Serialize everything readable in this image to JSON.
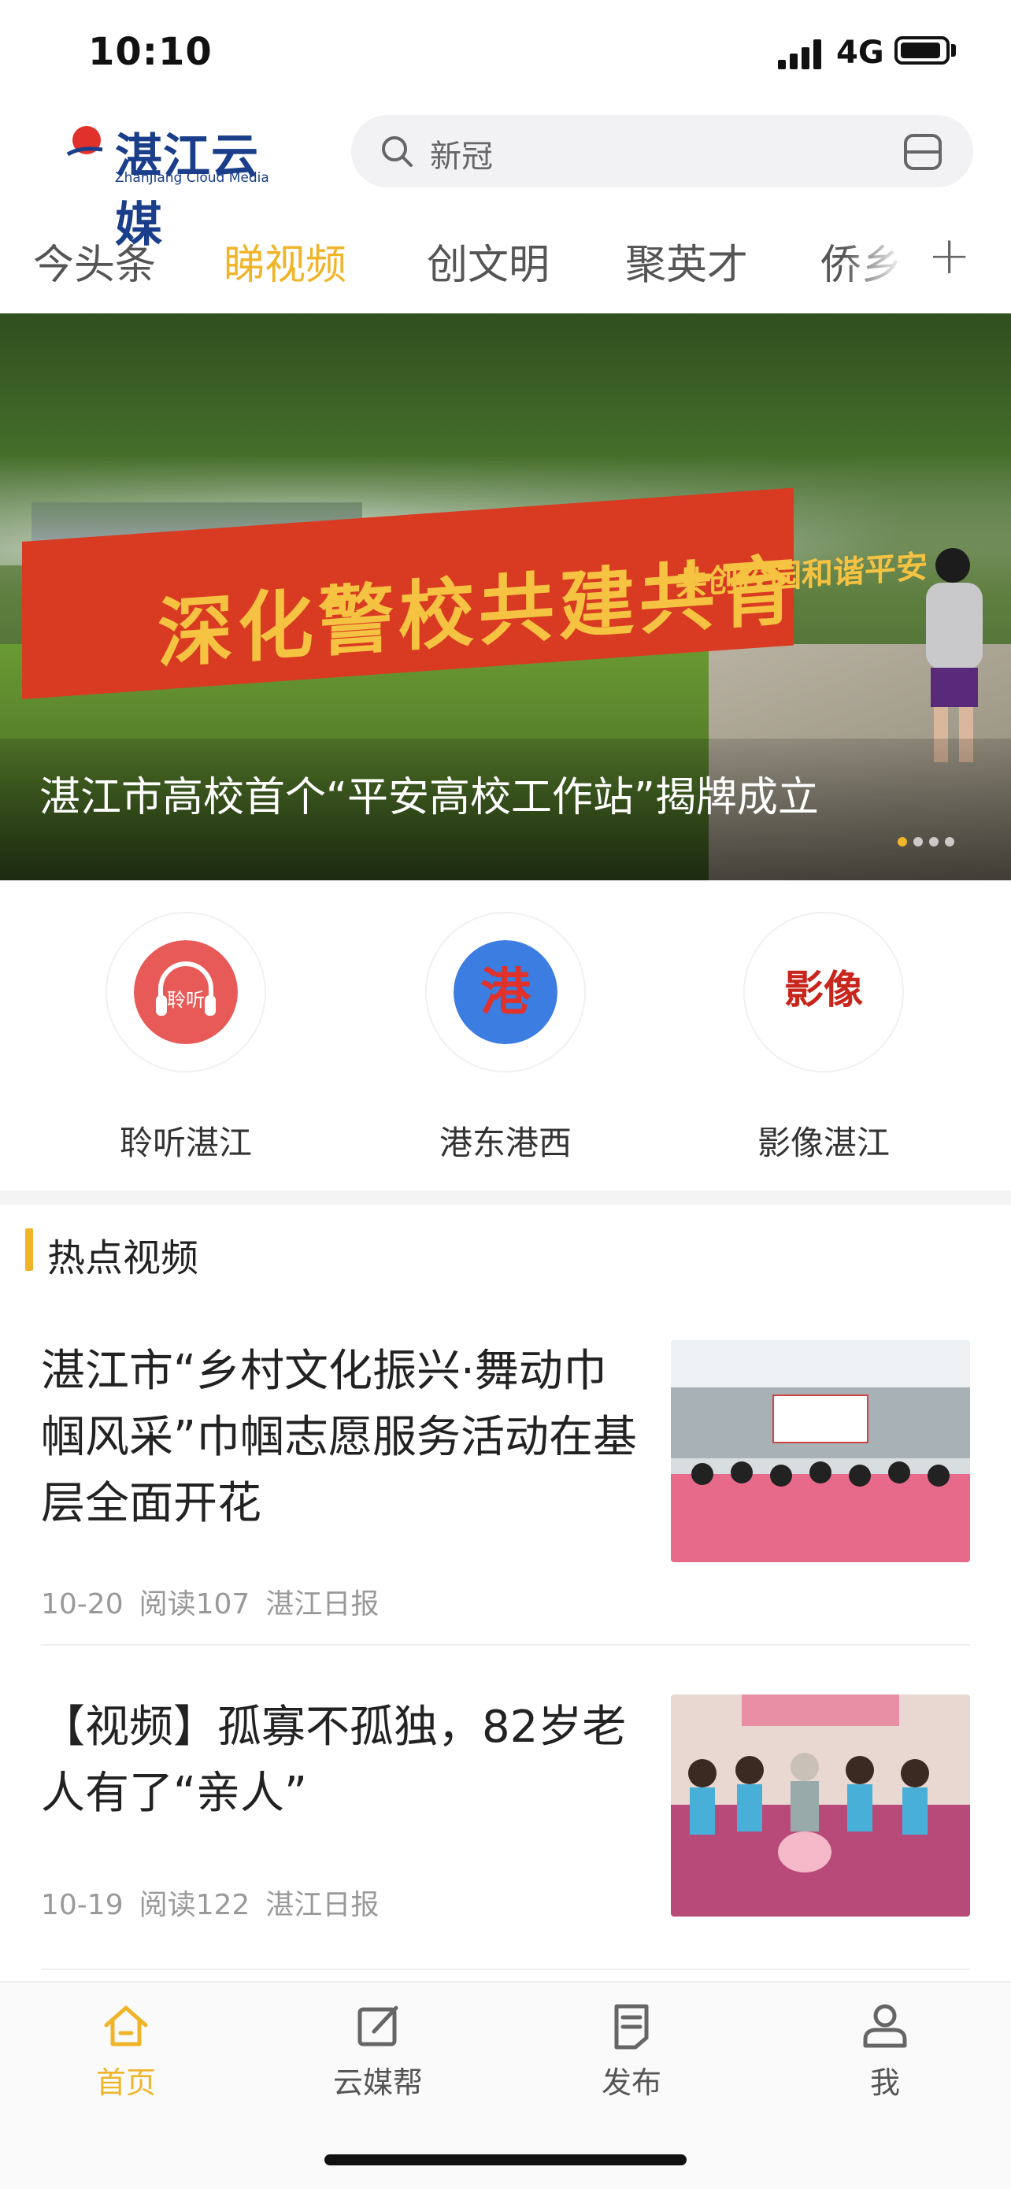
{
  "status": {
    "time": "10:10",
    "network": "4G"
  },
  "header": {
    "logo_text": "湛江云媒",
    "logo_sub": "ZhanJiang Cloud Media",
    "search_placeholder": "新冠"
  },
  "tabs": [
    {
      "label": "今头条",
      "active": false
    },
    {
      "label": "睇视频",
      "active": true
    },
    {
      "label": "创文明",
      "active": false
    },
    {
      "label": "聚英才",
      "active": false
    },
    {
      "label": "侨乡",
      "active": false
    }
  ],
  "hero": {
    "banner_text": "深化警校共建共育",
    "banner_text2": "共创校园和谐平安",
    "caption": "湛江市高校首个“平安高校工作站”揭牌成立",
    "dots": 4,
    "active_dot": 0
  },
  "quick": [
    {
      "label": "聆听湛江",
      "icon": "headphones-icon",
      "color": "#e85a58",
      "glyph": "聆听"
    },
    {
      "label": "港东港西",
      "icon": "harbor-icon",
      "color": "#3b7de0",
      "glyph": "港"
    },
    {
      "label": "影像湛江",
      "icon": "image-icon",
      "color": "#ffffff",
      "glyph": "影像"
    }
  ],
  "section": {
    "title": "热点视频"
  },
  "news": [
    {
      "title": "湛江市“乡村文化振兴·舞动巾帼风采”巾帼志愿服务活动在基层全面开花",
      "date": "10-20",
      "reads": "阅读107",
      "source": "湛江日报"
    },
    {
      "title": "【视频】孤寡不孤独，82岁老人有了“亲人”",
      "date": "10-19",
      "reads": "阅读122",
      "source": "湛江日报"
    }
  ],
  "tabbar": [
    {
      "label": "首页",
      "icon": "home-icon",
      "active": true
    },
    {
      "label": "云媒帮",
      "icon": "edit-icon",
      "active": false
    },
    {
      "label": "发布",
      "icon": "publish-icon",
      "active": false
    },
    {
      "label": "我",
      "icon": "user-icon",
      "active": false
    }
  ],
  "colors": {
    "accent": "#f0b429",
    "brand": "#1a3e8a"
  }
}
